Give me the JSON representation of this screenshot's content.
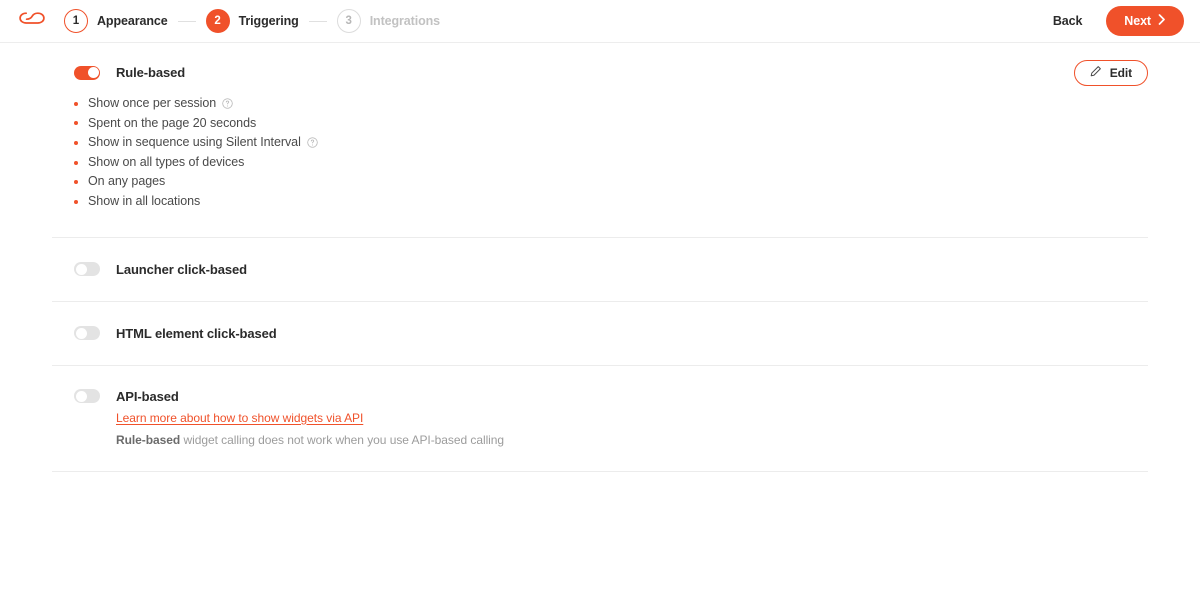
{
  "header": {
    "logo_icon": "cloud-logo-icon",
    "steps": [
      {
        "number": "1",
        "label": "Appearance",
        "state": "done"
      },
      {
        "number": "2",
        "label": "Triggering",
        "state": "active"
      },
      {
        "number": "3",
        "label": "Integrations",
        "state": "idle"
      }
    ],
    "back_label": "Back",
    "next_label": "Next",
    "next_icon": "chevron-right-icon"
  },
  "colors": {
    "accent": "#f0512a",
    "text": "#2b2b2b",
    "muted": "#9c9c9c",
    "divider": "#ececec",
    "toggle_off": "#e3e3e3"
  },
  "sections": {
    "rule_based": {
      "title": "Rule-based",
      "toggle_state": "on",
      "edit_label": "Edit",
      "edit_icon": "pencil-icon",
      "rules": [
        {
          "text": "Show once per session",
          "help": true
        },
        {
          "text": "Spent on the page 20 seconds",
          "help": false
        },
        {
          "text": "Show in sequence using Silent Interval",
          "help": true
        },
        {
          "text": "Show on all types of devices",
          "help": false
        },
        {
          "text": "On any pages",
          "help": false
        },
        {
          "text": "Show in all locations",
          "help": false
        }
      ]
    },
    "launcher_click": {
      "title": "Launcher click-based",
      "toggle_state": "off"
    },
    "html_element_click": {
      "title": "HTML element click-based",
      "toggle_state": "off"
    },
    "api_based": {
      "title": "API-based",
      "toggle_state": "off",
      "link_text": "Learn more about how to show widgets via API",
      "note_bold": "Rule-based",
      "note_rest": " widget calling does not work when you use API-based calling"
    }
  }
}
